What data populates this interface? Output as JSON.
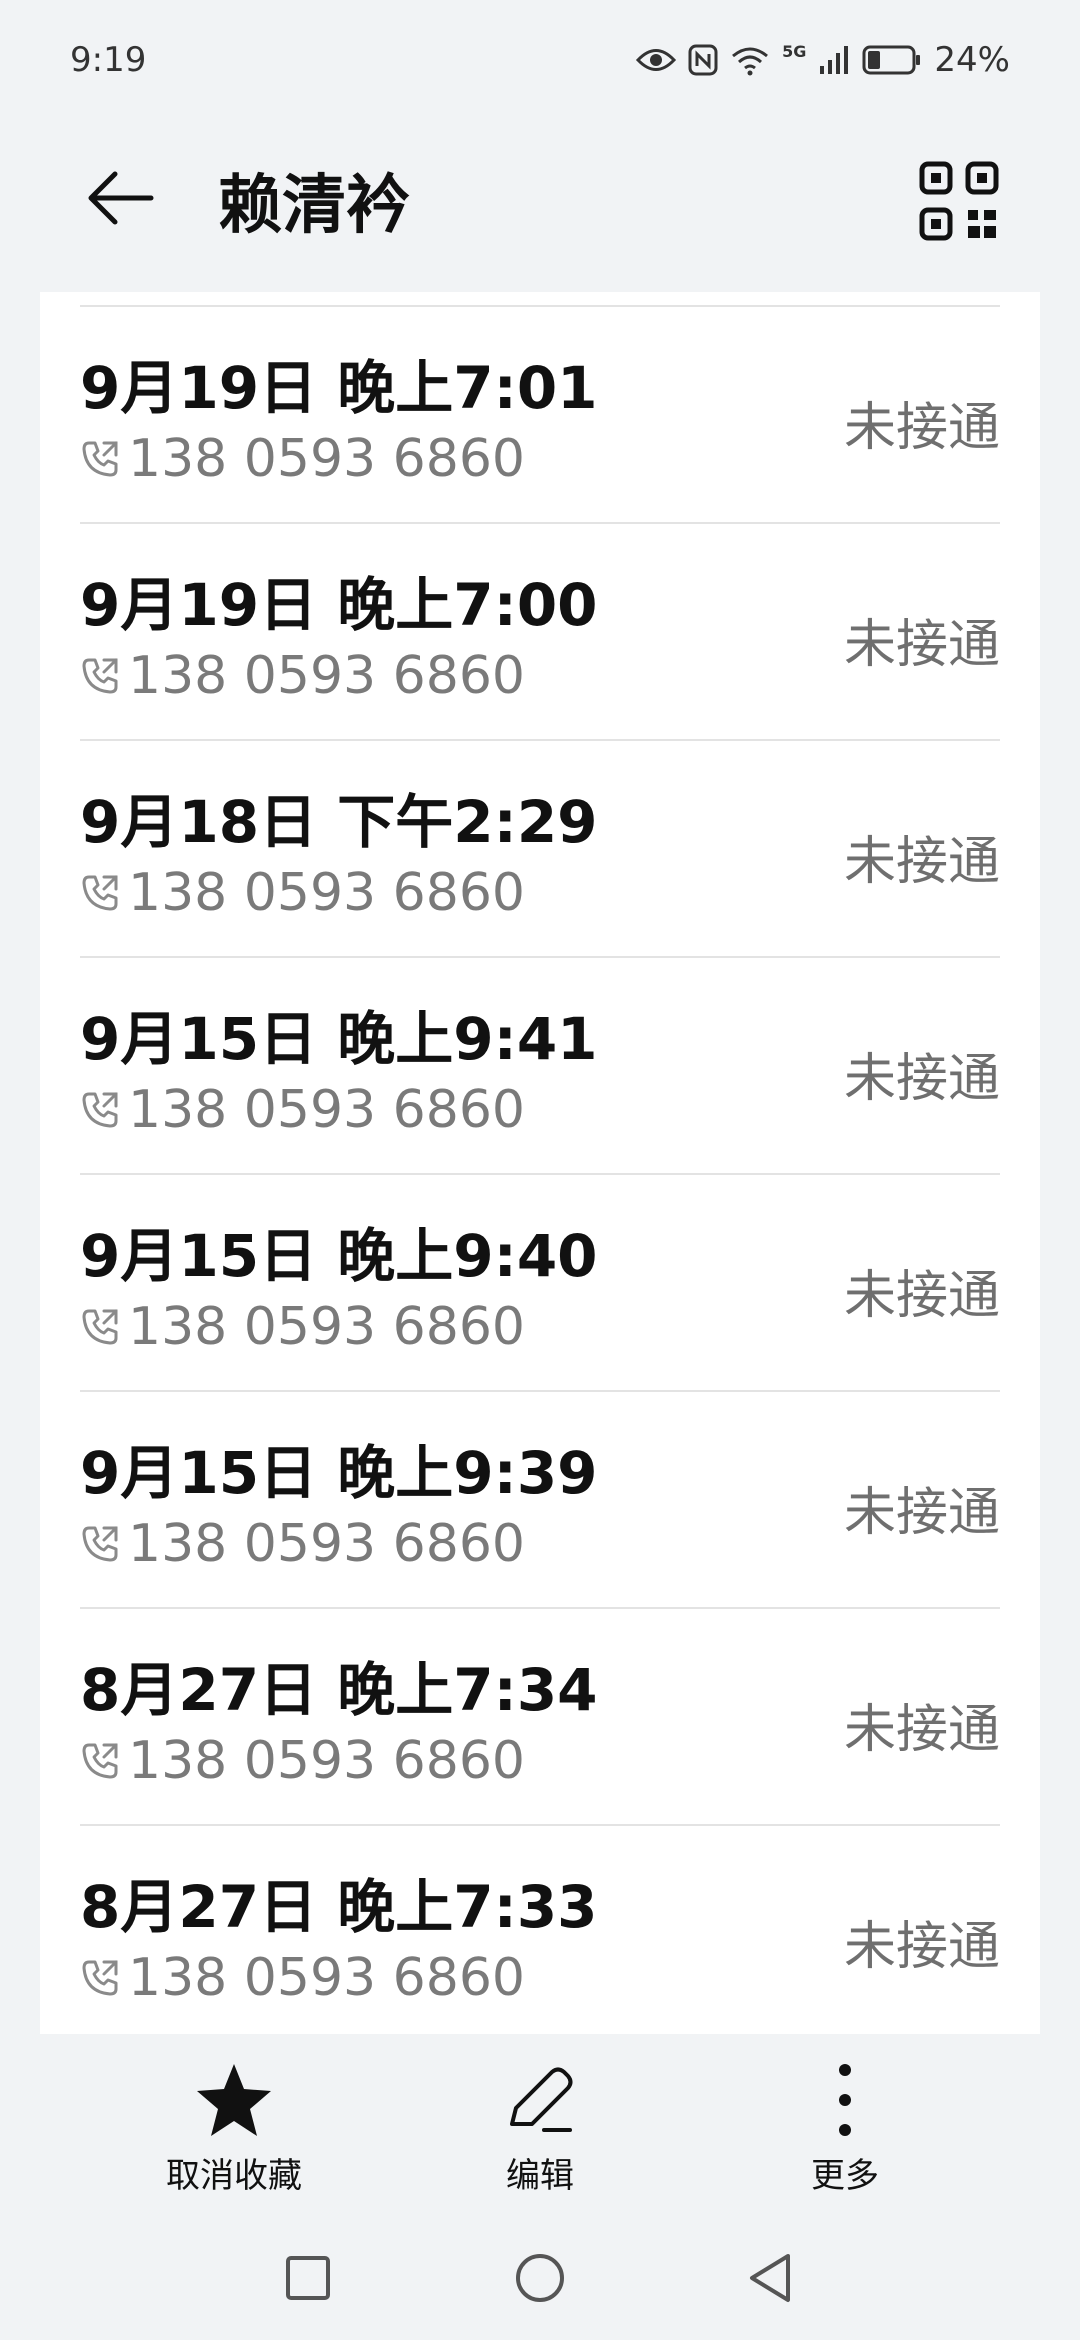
{
  "status_bar": {
    "time": "9:19",
    "network": "5G",
    "battery": "24%",
    "icons": [
      "eye-icon",
      "nfc-icon",
      "wifi-icon",
      "signal-icon",
      "battery-icon"
    ]
  },
  "header": {
    "title": "赖清衿",
    "back_icon": "back-arrow-icon",
    "qr_icon": "qr-code-icon"
  },
  "calls": [
    {
      "date": "9月19日 晚上7:01",
      "number": "138 0593 6860",
      "status": "未接通"
    },
    {
      "date": "9月19日 晚上7:00",
      "number": "138 0593 6860",
      "status": "未接通"
    },
    {
      "date": "9月18日 下午2:29",
      "number": "138 0593 6860",
      "status": "未接通"
    },
    {
      "date": "9月15日 晚上9:41",
      "number": "138 0593 6860",
      "status": "未接通"
    },
    {
      "date": "9月15日 晚上9:40",
      "number": "138 0593 6860",
      "status": "未接通"
    },
    {
      "date": "9月15日 晚上9:39",
      "number": "138 0593 6860",
      "status": "未接通"
    },
    {
      "date": "8月27日 晚上7:34",
      "number": "138 0593 6860",
      "status": "未接通"
    },
    {
      "date": "8月27日 晚上7:33",
      "number": "138 0593 6860",
      "status": "未接通"
    }
  ],
  "toolbar": {
    "unfavorite_label": "取消收藏",
    "edit_label": "编辑",
    "more_label": "更多"
  },
  "colors": {
    "background": "#f1f3f5",
    "card": "#ffffff",
    "secondary_text": "#7a7a7a"
  }
}
